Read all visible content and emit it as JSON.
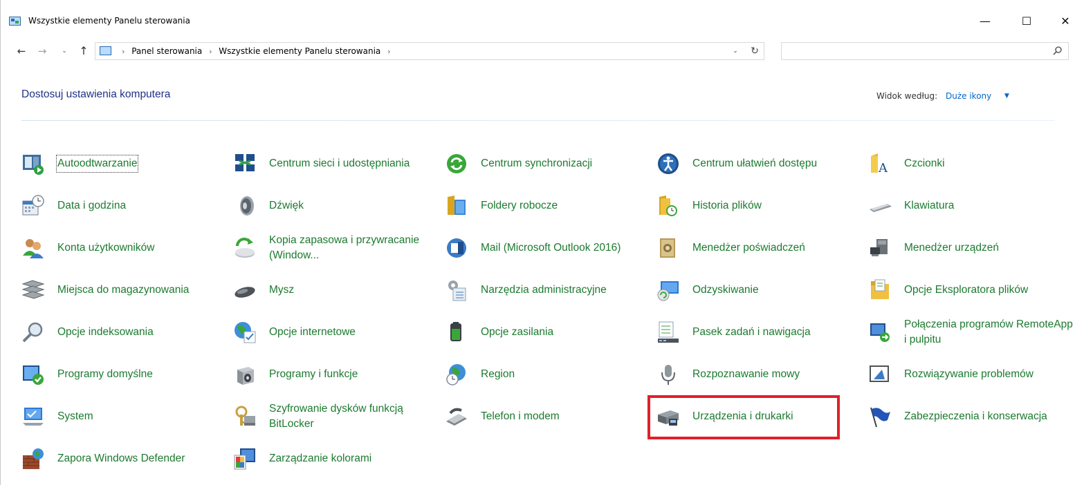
{
  "window": {
    "title": "Wszystkie elementy Panelu sterowania",
    "minimize": "—",
    "maximize": "☐",
    "close": "✕"
  },
  "navbar": {
    "back": "←",
    "forward": "→",
    "recent": "⌄",
    "up": "↑",
    "breadcrumb": [
      "Panel sterowania",
      "Wszystkie elementy Panelu sterowania"
    ],
    "sep": "›",
    "dropdown": "⌄",
    "refresh": "↻",
    "search_placeholder": ""
  },
  "header": {
    "title": "Dostosuj ustawienia komputera",
    "view_label": "Widok według:",
    "view_value": "Duże ikony",
    "view_caret": "▼"
  },
  "items": [
    {
      "label": "Autoodtwarzanie",
      "icon": "autoplay-icon"
    },
    {
      "label": "Centrum sieci i udostępniania",
      "icon": "network-center-icon"
    },
    {
      "label": "Centrum synchronizacji",
      "icon": "sync-center-icon"
    },
    {
      "label": "Centrum ułatwień dostępu",
      "icon": "ease-of-access-icon"
    },
    {
      "label": "Czcionki",
      "icon": "fonts-icon"
    },
    {
      "label": "Data i godzina",
      "icon": "date-time-icon"
    },
    {
      "label": "Dźwięk",
      "icon": "sound-icon"
    },
    {
      "label": "Foldery robocze",
      "icon": "work-folders-icon"
    },
    {
      "label": "Historia plików",
      "icon": "file-history-icon"
    },
    {
      "label": "Klawiatura",
      "icon": "keyboard-icon"
    },
    {
      "label": "Konta użytkowników",
      "icon": "user-accounts-icon"
    },
    {
      "label": "Kopia zapasowa i przywracanie (Window...",
      "icon": "backup-restore-icon"
    },
    {
      "label": "Mail (Microsoft Outlook 2016)",
      "icon": "mail-icon"
    },
    {
      "label": "Menedżer poświadczeń",
      "icon": "credential-manager-icon"
    },
    {
      "label": "Menedżer urządzeń",
      "icon": "device-manager-icon"
    },
    {
      "label": "Miejsca do magazynowania",
      "icon": "storage-spaces-icon"
    },
    {
      "label": "Mysz",
      "icon": "mouse-icon"
    },
    {
      "label": "Narzędzia administracyjne",
      "icon": "admin-tools-icon"
    },
    {
      "label": "Odzyskiwanie",
      "icon": "recovery-icon"
    },
    {
      "label": "Opcje Eksploratora plików",
      "icon": "file-explorer-options-icon"
    },
    {
      "label": "Opcje indeksowania",
      "icon": "indexing-options-icon"
    },
    {
      "label": "Opcje internetowe",
      "icon": "internet-options-icon"
    },
    {
      "label": "Opcje zasilania",
      "icon": "power-options-icon"
    },
    {
      "label": "Pasek zadań i nawigacja",
      "icon": "taskbar-icon"
    },
    {
      "label": "Połączenia programów RemoteApp i pulpitu",
      "icon": "remoteapp-icon"
    },
    {
      "label": "Programy domyślne",
      "icon": "default-programs-icon"
    },
    {
      "label": "Programy i funkcje",
      "icon": "programs-features-icon"
    },
    {
      "label": "Region",
      "icon": "region-icon"
    },
    {
      "label": "Rozpoznawanie mowy",
      "icon": "speech-recognition-icon"
    },
    {
      "label": "Rozwiązywanie problemów",
      "icon": "troubleshooting-icon"
    },
    {
      "label": "System",
      "icon": "system-icon"
    },
    {
      "label": "Szyfrowanie dysków funkcją BitLocker",
      "icon": "bitlocker-icon"
    },
    {
      "label": "Telefon i modem",
      "icon": "phone-modem-icon"
    },
    {
      "label": "Urządzenia i drukarki",
      "icon": "devices-printers-icon"
    },
    {
      "label": "Zabezpieczenia i konserwacja",
      "icon": "security-maintenance-icon"
    },
    {
      "label": "Zapora Windows Defender",
      "icon": "firewall-icon"
    },
    {
      "label": "Zarządzanie kolorami",
      "icon": "color-management-icon"
    }
  ],
  "colors": {
    "link": "#1c7a2f",
    "title": "#1e3287",
    "highlight": "#e0202a"
  }
}
